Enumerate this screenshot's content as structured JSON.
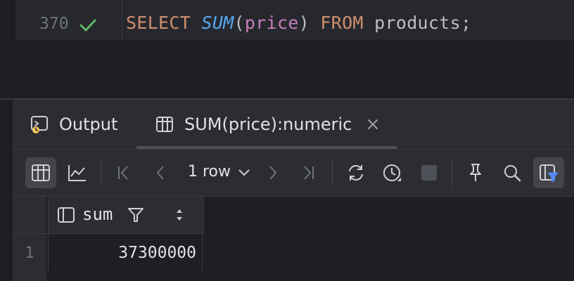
{
  "editor": {
    "line_number": "370",
    "code": {
      "select": "SELECT",
      "func": "SUM",
      "paren_open": "(",
      "column": "price",
      "paren_close": ")",
      "from": "FROM",
      "table": "products;"
    }
  },
  "tabs": [
    {
      "label": "Output",
      "icon": "console-icon"
    },
    {
      "label": "SUM(price):numeric",
      "icon": "table-icon",
      "closable": true,
      "active": true
    }
  ],
  "toolbar": {
    "row_count": "1 row",
    "icons": [
      "table-view-icon",
      "chart-view-icon",
      "first-page-icon",
      "previous-page-icon",
      "next-page-icon",
      "last-page-icon",
      "refresh-icon",
      "history-icon",
      "stop-icon",
      "pin-icon",
      "search-icon",
      "filter-view-icon"
    ]
  },
  "grid": {
    "columns": [
      {
        "name": "sum"
      }
    ],
    "rows": [
      {
        "row_number": "1",
        "values": [
          "37300000"
        ]
      }
    ]
  },
  "colors": {
    "keyword": "#cf8e6d",
    "function": "#56a8f5",
    "column": "#c77dbb",
    "success_check": "#5fb865",
    "accent": "#548af7"
  }
}
